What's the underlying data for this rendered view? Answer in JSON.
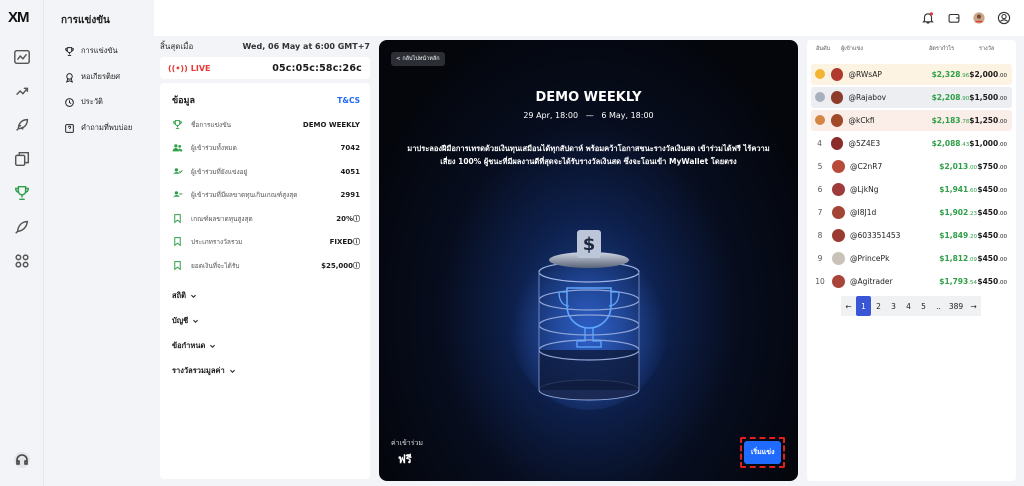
{
  "brand": {
    "logo": "XM"
  },
  "sidebar": {
    "title": "การแข่งขัน",
    "items": [
      {
        "label": "การแข่งขัน",
        "icon": "trophy-icon"
      },
      {
        "label": "หอเกียรติยศ",
        "icon": "medal-icon"
      },
      {
        "label": "ประวัติ",
        "icon": "history-icon"
      },
      {
        "label": "คำถามที่พบบ่อย",
        "icon": "question-icon"
      }
    ]
  },
  "rail": {
    "icons": [
      "chart-icon",
      "swap-icon",
      "rocket-icon",
      "copy-icon",
      "trophy-icon",
      "launch-icon",
      "apps-icon"
    ],
    "help_icon": "headset-icon"
  },
  "topbar": {
    "icons": [
      "bell-icon",
      "wallet-icon",
      "avatar",
      "user-icon"
    ],
    "colors": {
      "notification_dot": "#e53935"
    }
  },
  "status": {
    "ends_label": "สิ้นสุดเมื่อ",
    "ends_value": "Wed, 06 May at 6:00 GMT+7",
    "live_label": "LIVE",
    "countdown": "05c:05c:58c:26c"
  },
  "info": {
    "title": "ข้อมูล",
    "tcs": "T&CS",
    "rows": [
      {
        "label": "ชื่อการแข่งขัน",
        "value": "DEMO WEEKLY"
      },
      {
        "label": "ผู้เข้าร่วมทั้งหมด",
        "value": "7042"
      },
      {
        "label": "ผู้เข้าร่วมที่ยังแข่งอยู่",
        "value": "4051"
      },
      {
        "label": "ผู้เข้าร่วมที่มีผลขาดทุนเกินเกณฑ์สูงสุด",
        "value": "2991"
      },
      {
        "label": "เกณฑ์ผลขาดทุนสูงสุด",
        "value": "20%ⓘ"
      },
      {
        "label": "ประเภทรางวัลรวม",
        "value": "FIXEDⓘ"
      },
      {
        "label": "ยอดเงินที่จะได้รับ",
        "value": "$25,000ⓘ"
      }
    ],
    "collapsibles": [
      "สถิติ",
      "บัญชี",
      "ข้อกำหนด",
      "รางวัลรวมมูลค่า"
    ]
  },
  "hero": {
    "back_label": "< กลับไปหน้าหลัก",
    "title": "DEMO WEEKLY",
    "date_start": "29 Apr, 18:00",
    "date_sep": "—",
    "date_end": "6 May, 18:00",
    "description": "มาประลองฝีมือการเทรดด้วยเงินทุนเสมือนได้ทุกสัปดาห์ พร้อมคว้าโอกาสชนะรางวัลเงินสด เข้าร่วมได้ฟรี ไร้ความเสี่ยง 100% ผู้ชนะที่มีผลงานดีที่สุดจะได้รับรางวัลเงินสด ซึ่งจะโอนเข้า MyWallet โดยตรง",
    "fee_label": "ค่าเข้าร่วม",
    "fee_value": "ฟรี",
    "start_button": "เริ่มแข่ง",
    "colors": {
      "button": "#1f6bff",
      "highlight_border": "#e0201f"
    }
  },
  "leaderboard": {
    "headers": {
      "rank": "อันดับ",
      "user": "ผู้เข้าแข่ง",
      "pnl": "อัตรากำไร",
      "prize": "รางวัล"
    },
    "rows": [
      {
        "rank": "1",
        "medal": "gold",
        "user": "@RWsAP",
        "pnl": "$2,328",
        "pnl_c": ".96",
        "prize": "$2,000",
        "prize_c": ".00",
        "highlight": "#fdf3e3"
      },
      {
        "rank": "2",
        "medal": "silver",
        "user": "@Rajabov",
        "pnl": "$2,208",
        "pnl_c": ".90",
        "prize": "$1,500",
        "prize_c": ".00",
        "highlight": "#eceef2"
      },
      {
        "rank": "3",
        "medal": "bronze",
        "user": "@kCkfi",
        "pnl": "$2,183",
        "pnl_c": ".78",
        "prize": "$1,250",
        "prize_c": ".00",
        "highlight": "#fbeee8"
      },
      {
        "rank": "4",
        "user": "@5Z4E3",
        "pnl": "$2,088",
        "pnl_c": ".43",
        "prize": "$1,000",
        "prize_c": ".00"
      },
      {
        "rank": "5",
        "user": "@C2nR7",
        "pnl": "$2,013",
        "pnl_c": ".00",
        "prize": "$750",
        "prize_c": ".00"
      },
      {
        "rank": "6",
        "user": "@LjkNg",
        "pnl": "$1,941",
        "pnl_c": ".60",
        "prize": "$450",
        "prize_c": ".00"
      },
      {
        "rank": "7",
        "user": "@I8J1d",
        "pnl": "$1,902",
        "pnl_c": ".23",
        "prize": "$450",
        "prize_c": ".00"
      },
      {
        "rank": "8",
        "user": "@603351453",
        "pnl": "$1,849",
        "pnl_c": ".20",
        "prize": "$450",
        "prize_c": ".00"
      },
      {
        "rank": "9",
        "user": "@PrincePk",
        "pnl": "$1,812",
        "pnl_c": ".09",
        "prize": "$450",
        "prize_c": ".00"
      },
      {
        "rank": "10",
        "user": "@Agitrader",
        "pnl": "$1,793",
        "pnl_c": ".54",
        "prize": "$450",
        "prize_c": ".00"
      }
    ],
    "pagination": {
      "prev": "←",
      "pages": [
        "1",
        "2",
        "3",
        "4",
        "5",
        "..",
        "389"
      ],
      "next": "→",
      "current": "1"
    }
  }
}
